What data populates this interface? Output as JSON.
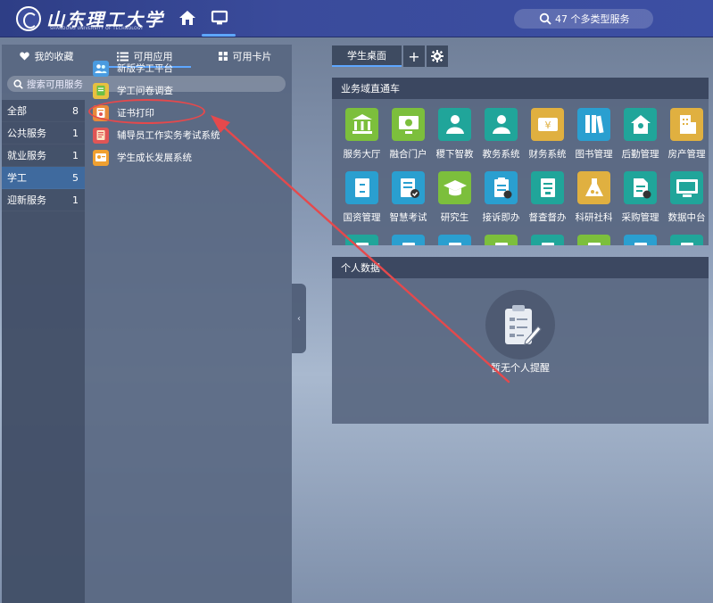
{
  "header": {
    "logo_cn": "山东理工大学",
    "logo_en": "SHANDONG UNIVERSITY OF TECHNOLOGY",
    "search_label": "47 个多类型服务"
  },
  "left": {
    "tabs": [
      {
        "label": "我的收藏",
        "icon": "heart-icon"
      },
      {
        "label": "可用应用",
        "icon": "list-icon"
      },
      {
        "label": "可用卡片",
        "icon": "grid-icon"
      }
    ],
    "search_placeholder": "搜索可用服务",
    "categories": [
      {
        "label": "全部",
        "count": "8"
      },
      {
        "label": "公共服务",
        "count": "1"
      },
      {
        "label": "就业服务",
        "count": "1"
      },
      {
        "label": "学工",
        "count": "5"
      },
      {
        "label": "迎新服务",
        "count": "1"
      }
    ],
    "apps": [
      {
        "label": "新版学工平台",
        "icon": "people-icon",
        "color": "#4a9be0"
      },
      {
        "label": "学工问卷调查",
        "icon": "survey-icon",
        "color": "#e8c040"
      },
      {
        "label": "证书打印",
        "icon": "certificate-icon",
        "color": "#e88a3a"
      },
      {
        "label": "辅导员工作实务考试系统",
        "icon": "exam-icon",
        "color": "#e05555"
      },
      {
        "label": "学生成长发展系统",
        "icon": "growth-icon",
        "color": "#f0a030"
      }
    ]
  },
  "desk": {
    "tab": "学生桌面",
    "add": "+",
    "settings_icon": "gear-icon"
  },
  "biz": {
    "title": "业务域直通车",
    "services": [
      {
        "label": "服务大厅",
        "color": "#7cbf3c",
        "icon": "bank-icon"
      },
      {
        "label": "融合门户",
        "color": "#7cbf3c",
        "icon": "monitor-icon"
      },
      {
        "label": "稷下智教",
        "color": "#20a59a",
        "icon": "teacher-icon"
      },
      {
        "label": "教务系统",
        "color": "#20a59a",
        "icon": "person-icon"
      },
      {
        "label": "财务系统",
        "color": "#e0b040",
        "icon": "yen-icon"
      },
      {
        "label": "图书管理",
        "color": "#2a9fd0",
        "icon": "books-icon"
      },
      {
        "label": "后勤管理",
        "color": "#20a59a",
        "icon": "house-icon"
      },
      {
        "label": "房产管理",
        "color": "#e0b040",
        "icon": "building-icon"
      },
      {
        "label": "国资管理",
        "color": "#2a9fd0",
        "icon": "cabinet-icon"
      },
      {
        "label": "智慧考试",
        "color": "#2a9fd0",
        "icon": "exam-sheet-icon"
      },
      {
        "label": "研究生",
        "color": "#7cbf3c",
        "icon": "graduation-icon"
      },
      {
        "label": "接诉即办",
        "color": "#2a9fd0",
        "icon": "clipboard-icon"
      },
      {
        "label": "督查督办",
        "color": "#20a59a",
        "icon": "checklist-icon"
      },
      {
        "label": "科研社科",
        "color": "#e0b040",
        "icon": "flask-icon"
      },
      {
        "label": "采购管理",
        "color": "#20a59a",
        "icon": "document-icon"
      },
      {
        "label": "数据中台",
        "color": "#20a59a",
        "icon": "screen-icon"
      }
    ],
    "partial_row_colors": [
      "#20a59a",
      "#2a9fd0",
      "#2a9fd0",
      "#7cbf3c",
      "#20a59a",
      "#7cbf3c",
      "#2a9fd0",
      "#20a59a"
    ]
  },
  "personal": {
    "title": "个人数据",
    "empty_text": "暂无个人提醒"
  },
  "annotation": {
    "color": "#e5494c"
  }
}
